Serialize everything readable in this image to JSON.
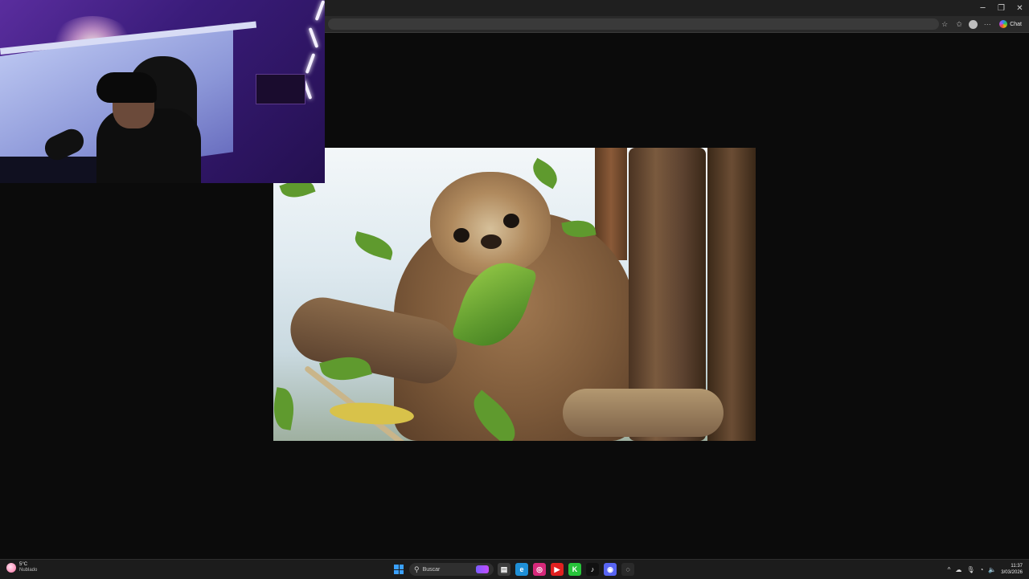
{
  "browser": {
    "window_controls": {
      "minimize": "─",
      "restore": "❐",
      "close": "✕"
    },
    "toolbar": {
      "favorite_glyph": "☆",
      "collections_glyph": "✩",
      "menu_glyph": "···",
      "chat_label": "Chat"
    }
  },
  "taskbar": {
    "weather": {
      "temp": "5°C",
      "desc": "Nublado"
    },
    "search": {
      "glyph": "⚲",
      "label": "Buscar"
    },
    "apps": [
      {
        "name": "file-explorer",
        "glyph": "▤",
        "color": "#3c3c3c"
      },
      {
        "name": "edge",
        "glyph": "e",
        "color": "#1f8fd6"
      },
      {
        "name": "instagram",
        "glyph": "◎",
        "color": "#d6297a"
      },
      {
        "name": "youtube",
        "glyph": "▶",
        "color": "#e02020"
      },
      {
        "name": "kick",
        "glyph": "K",
        "color": "#27c43a"
      },
      {
        "name": "tiktok",
        "glyph": "♪",
        "color": "#111111"
      },
      {
        "name": "discord",
        "glyph": "◉",
        "color": "#5865f2"
      },
      {
        "name": "chrome",
        "glyph": "◌",
        "color": "#2a2a2a"
      }
    ],
    "tray": {
      "chevron": "^",
      "cloud": "☁",
      "mic": "🎙",
      "wifi": "◔",
      "volume": "🔈",
      "time": "11:37",
      "date": "3/03/2026"
    }
  }
}
